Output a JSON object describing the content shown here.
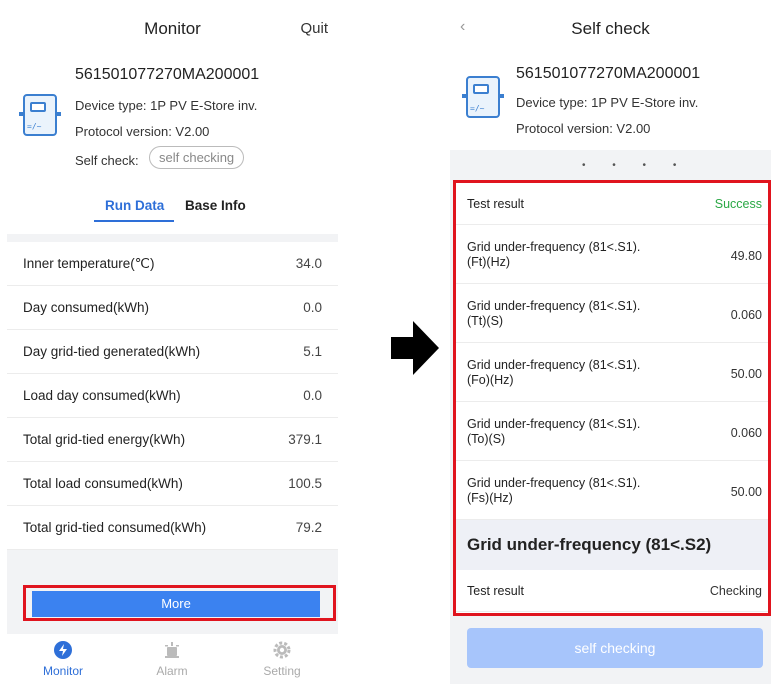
{
  "monitor_screen": {
    "title": "Monitor",
    "quit_label": "Quit",
    "device": {
      "serial": "561501077270MA200001",
      "device_type": "Device type: 1P PV E-Store inv.",
      "protocol_version": "Protocol version: V2.00",
      "self_check_label": "Self check:",
      "self_check_button": "self checking"
    },
    "tabs": [
      {
        "label": "Run Data",
        "active": true
      },
      {
        "label": "Base Info",
        "active": false
      }
    ],
    "rows": [
      {
        "label": "Inner temperature(℃)",
        "value": "34.0"
      },
      {
        "label": "Day consumed(kWh)",
        "value": "0.0"
      },
      {
        "label": "Day grid-tied generated(kWh)",
        "value": "5.1"
      },
      {
        "label": "Load day consumed(kWh)",
        "value": "0.0"
      },
      {
        "label": "Total grid-tied energy(kWh)",
        "value": "379.1"
      },
      {
        "label": "Total load consumed(kWh)",
        "value": "100.5"
      },
      {
        "label": "Total grid-tied consumed(kWh)",
        "value": "79.2"
      }
    ],
    "more_button": "More",
    "nav": [
      {
        "label": "Monitor",
        "icon": "monitor-icon",
        "active": true
      },
      {
        "label": "Alarm",
        "icon": "alarm-icon",
        "active": false
      },
      {
        "label": "Setting",
        "icon": "gear-icon",
        "active": false
      }
    ]
  },
  "self_check_screen": {
    "title": "Self check",
    "back_icon": "chevron-left-icon",
    "device": {
      "serial": "561501077270MA200001",
      "device_type": "Device type: 1P PV E-Store inv.",
      "protocol_version": "Protocol version: V2.00"
    },
    "results": [
      {
        "label": "Test result",
        "value": "Success"
      },
      {
        "label": "Grid under-frequency (81<.S1).\n(Ft)(Hz)",
        "value": "49.80"
      },
      {
        "label": "Grid under-frequency (81<.S1).\n(Tt)(S)",
        "value": "0.060"
      },
      {
        "label": "Grid under-frequency (81<.S1).\n(Fo)(Hz)",
        "value": "50.00"
      },
      {
        "label": "Grid under-frequency (81<.S1).\n(To)(S)",
        "value": "0.060"
      },
      {
        "label": "Grid under-frequency (81<.S1).\n(Fs)(Hz)",
        "value": "50.00"
      }
    ],
    "section_title": "Grid under-frequency (81<.S2)",
    "section_rows": [
      {
        "label": "Test result",
        "value": "Checking"
      }
    ],
    "self_check_button": "self checking"
  },
  "colors": {
    "accent": "#2e6fd8",
    "button_blue": "#3b82f0",
    "highlight_red": "#e0141e",
    "success_green": "#2aa845",
    "disabled_blue": "#a7c5fb"
  }
}
